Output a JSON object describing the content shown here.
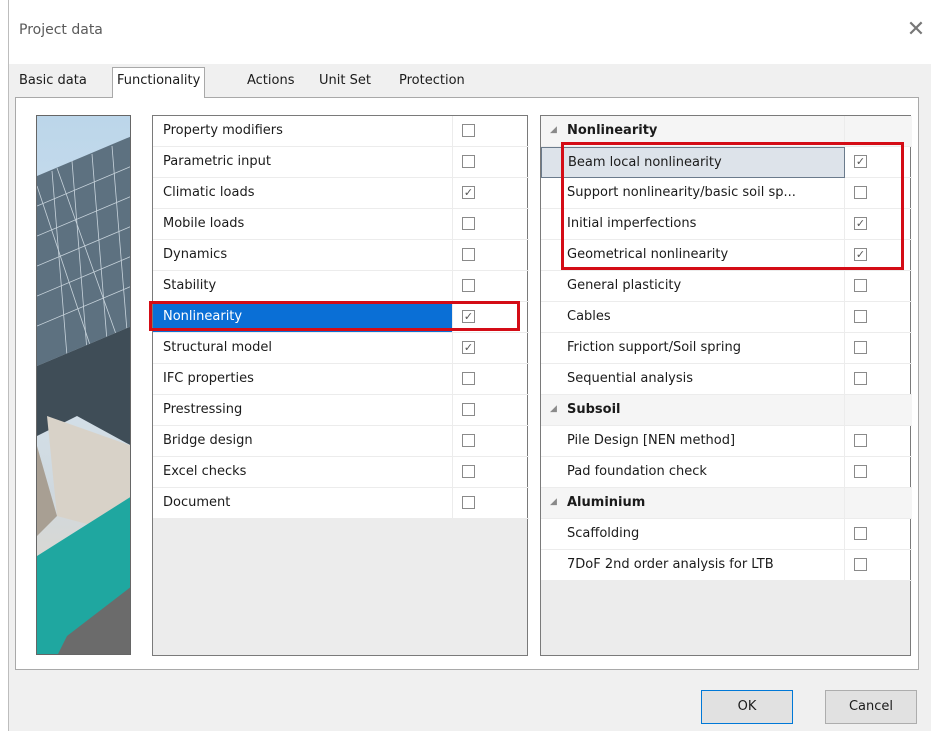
{
  "window": {
    "title": "Project data",
    "close_glyph": "✕"
  },
  "tabs": [
    {
      "label": "Basic data",
      "active": false
    },
    {
      "label": "Functionality",
      "active": true
    },
    {
      "label": "Actions",
      "active": false
    },
    {
      "label": "Unit Set",
      "active": false
    },
    {
      "label": "Protection",
      "active": false
    }
  ],
  "left_list": [
    {
      "label": "Property modifiers",
      "checked": false
    },
    {
      "label": "Parametric input",
      "checked": false
    },
    {
      "label": "Climatic loads",
      "checked": true
    },
    {
      "label": "Mobile loads",
      "checked": false
    },
    {
      "label": "Dynamics",
      "checked": false
    },
    {
      "label": "Stability",
      "checked": false
    },
    {
      "label": "Nonlinearity",
      "checked": true,
      "selected": true
    },
    {
      "label": "Structural model",
      "checked": true
    },
    {
      "label": "IFC properties",
      "checked": false
    },
    {
      "label": "Prestressing",
      "checked": false
    },
    {
      "label": "Bridge design",
      "checked": false
    },
    {
      "label": "Excel checks",
      "checked": false
    },
    {
      "label": "Document",
      "checked": false
    }
  ],
  "right_list": [
    {
      "label": "Nonlinearity",
      "group": true
    },
    {
      "label": "Beam local nonlinearity",
      "checked": true,
      "focused": true
    },
    {
      "label": "Support nonlinearity/basic soil sp...",
      "checked": false
    },
    {
      "label": "Initial imperfections",
      "checked": true
    },
    {
      "label": "Geometrical nonlinearity",
      "checked": true
    },
    {
      "label": "General plasticity",
      "checked": false
    },
    {
      "label": "Cables",
      "checked": false
    },
    {
      "label": "Friction support/Soil spring",
      "checked": false
    },
    {
      "label": "Sequential analysis",
      "checked": false
    },
    {
      "label": "Subsoil",
      "group": true
    },
    {
      "label": "Pile Design [NEN method]",
      "checked": false
    },
    {
      "label": "Pad foundation check",
      "checked": false
    },
    {
      "label": "Aluminium",
      "group": true
    },
    {
      "label": "Scaffolding",
      "checked": false
    },
    {
      "label": "7DoF 2nd order analysis for LTB",
      "checked": false
    }
  ],
  "buttons": {
    "ok": "OK",
    "cancel": "Cancel"
  },
  "check_glyph": "✓",
  "colors": {
    "selection": "#0a6fd6",
    "highlight_box": "#d40c16",
    "focus": "#dde3ea"
  }
}
